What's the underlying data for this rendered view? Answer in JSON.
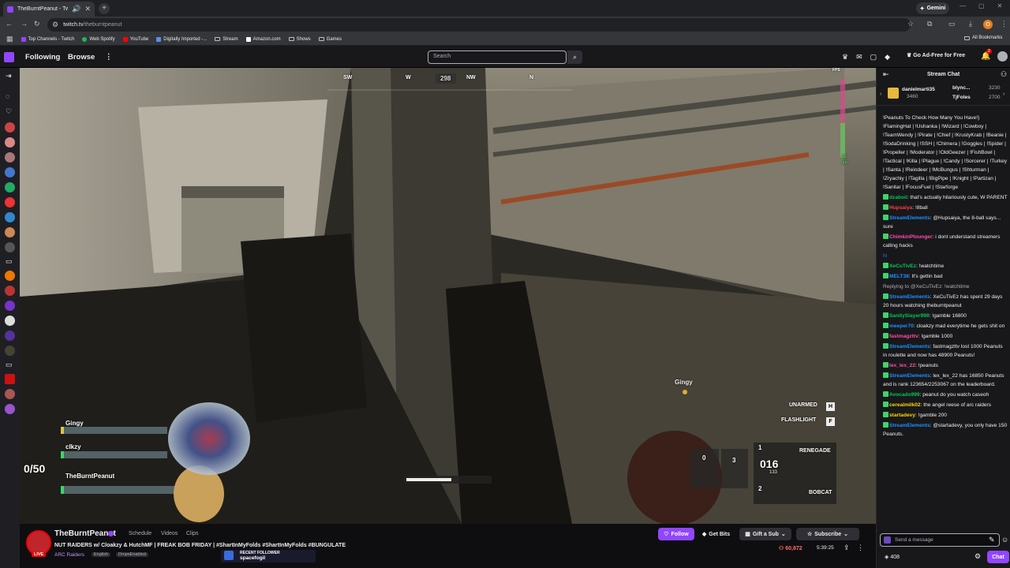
{
  "browser": {
    "tab_title": "TheBurntPeanut - Twitch",
    "url_host": "twitch.tv",
    "url_path": "/theburntpeanut",
    "gemini_label": "Gemini",
    "profile_initial": "O",
    "bookmarks": [
      "Top Channels - Twitch",
      "Web Spotify",
      "YouTube",
      "Digitally Imported -...",
      "Stream",
      "Amazon.com",
      "Shows",
      "Games"
    ],
    "all_bookmarks": "All Bookmarks"
  },
  "nav": {
    "following": "Following",
    "browse": "Browse",
    "more": "⋮",
    "search_placeholder": "Search",
    "ad_free": "Go Ad-Free for Free",
    "notif_count": "2"
  },
  "hud": {
    "compass": [
      "SW",
      "W",
      "298",
      "NW",
      "N"
    ],
    "party": [
      "Gingy",
      "clkzy",
      "TheBurntPeanut"
    ],
    "counter": "0/50",
    "teammate_marker": "Gingy",
    "unarmed_label": "UNARMED",
    "unarmed_key": "H",
    "flashlight_label": "FLASHLIGHT",
    "flashlight_key": "F",
    "slot0": "0",
    "slot3": "3",
    "slot1": "1",
    "slot2": "2",
    "weapon_primary": "RENEGADE",
    "weapon_secondary": "BOBCAT",
    "ammo": "016",
    "ammo_reserve": "133",
    "fps_label": "FPS",
    "ap_label": "15",
    "ap_unit": "AP",
    "health_fill": 0.55
  },
  "stream": {
    "channel": "TheBurntPeanut",
    "tabs": [
      "Schedule",
      "Videos",
      "Clips"
    ],
    "title": "NUT RAIDERS w/ Cloakzy & HutchMF | FREAK BOB FRIDAY | #ShartInMyFolds #ShartInMyFolds #BUNGULATE",
    "category": "ARC Raiders",
    "tags": [
      "English",
      "DropsEnabled"
    ],
    "live": "LIVE",
    "follow": "Follow",
    "get_bits": "Get Bits",
    "gift_sub": "Gift a Sub",
    "subscribe": "Subscribe",
    "viewers": "60,872",
    "uptime": "5:39:25",
    "recent_follower_label": "RECENT FOLLOWER",
    "recent_follower_name": "spacefogil"
  },
  "chat": {
    "header": "Stream Chat",
    "leaders": [
      {
        "name": "danielmarti35",
        "amount": "3460"
      },
      {
        "name": "blync...",
        "amount": "3230"
      },
      {
        "name": "TjFoles",
        "amount": "2700"
      }
    ],
    "messages": [
      {
        "user": "",
        "color": "#efeff1",
        "text": "!Peanuts To Check How Many You Have!) !FlamingHat | !Ushanka | !Wizard | !Cowboy | !TeamWendy | !Pirate | !Chief | !KrustyKrab | !Beanie | !SodaDrinking | !SSH | !Chimera | !Goggles | !Spider | !Propeller | !Moderator | !OldGeezer | !FishBowl | !Tactical | !Killa | !Plague | !Candy | !Sorcerer | !Turkey | !Santa | !Reindeer | !McBungus | !Shturman | !Zryachiy | !Tagilla | !BigPipe | !Knight | !Partizan | !Sanitar | !FocusFuel | !Starforge"
      },
      {
        "user": "dzaboii",
        "color": "#00c853",
        "text": "that's actually hilariously cute, W PARENT"
      },
      {
        "user": "Hupsaiya",
        "color": "#ff4040",
        "text": "!8ball"
      },
      {
        "user": "StreamElements",
        "color": "#1e90ff",
        "text": "@Hupsaiya, the 8-ball says... sure"
      },
      {
        "user": "ChimkinPlounger",
        "color": "#ff4da6",
        "text": "i dont understand streamers calling hacks"
      },
      {
        "user": "",
        "color": "#2a6fdb",
        "text": "hi"
      },
      {
        "user": "XeCuTivEz",
        "color": "#00c853",
        "text": "!watchtime"
      },
      {
        "user": "MELT38",
        "color": "#1e90ff",
        "text": "It's gettin bad"
      },
      {
        "user": "",
        "color": "#adadb8",
        "text": "Replying to @XeCuTivEz: !watchtime"
      },
      {
        "user": "StreamElements",
        "color": "#1e90ff",
        "text": "XeCuTivEz has spent 29 days 20 hours watching theburntpeanut"
      },
      {
        "user": "SanitySlayer999",
        "color": "#00c853",
        "text": "!gamble 16800"
      },
      {
        "user": "meeper70",
        "color": "#1e90ff",
        "text": "cloakzy mad everytime he gets shit on"
      },
      {
        "user": "fastmagzttv",
        "color": "#ff4da6",
        "text": "!gamble 1000"
      },
      {
        "user": "StreamElements",
        "color": "#1e90ff",
        "text": "fastmagzttv lost 1000 Peanuts in roulette and now has 48900 Peanuts!"
      },
      {
        "user": "lex_lex_22",
        "color": "#ff4da6",
        "text": "!peanuts"
      },
      {
        "user": "StreamElements",
        "color": "#1e90ff",
        "text": "lex_lex_22 has 16850 Peanuts and is rank 123654/2253067 on the leaderboard."
      },
      {
        "user": "Avocado999",
        "color": "#00c853",
        "text": "peanut do you watch caseoh"
      },
      {
        "user": "cerealmilk02",
        "color": "#ffd700",
        "text": "the angel reese of arc raiders"
      },
      {
        "user": "startadevy",
        "color": "#ffd700",
        "text": "!gamble 200"
      },
      {
        "user": "StreamElements",
        "color": "#1e90ff",
        "text": "@startadevy, you only have 150 Peanuts."
      }
    ],
    "input_placeholder": "Send a message",
    "points": "408",
    "chat_button": "Chat"
  }
}
